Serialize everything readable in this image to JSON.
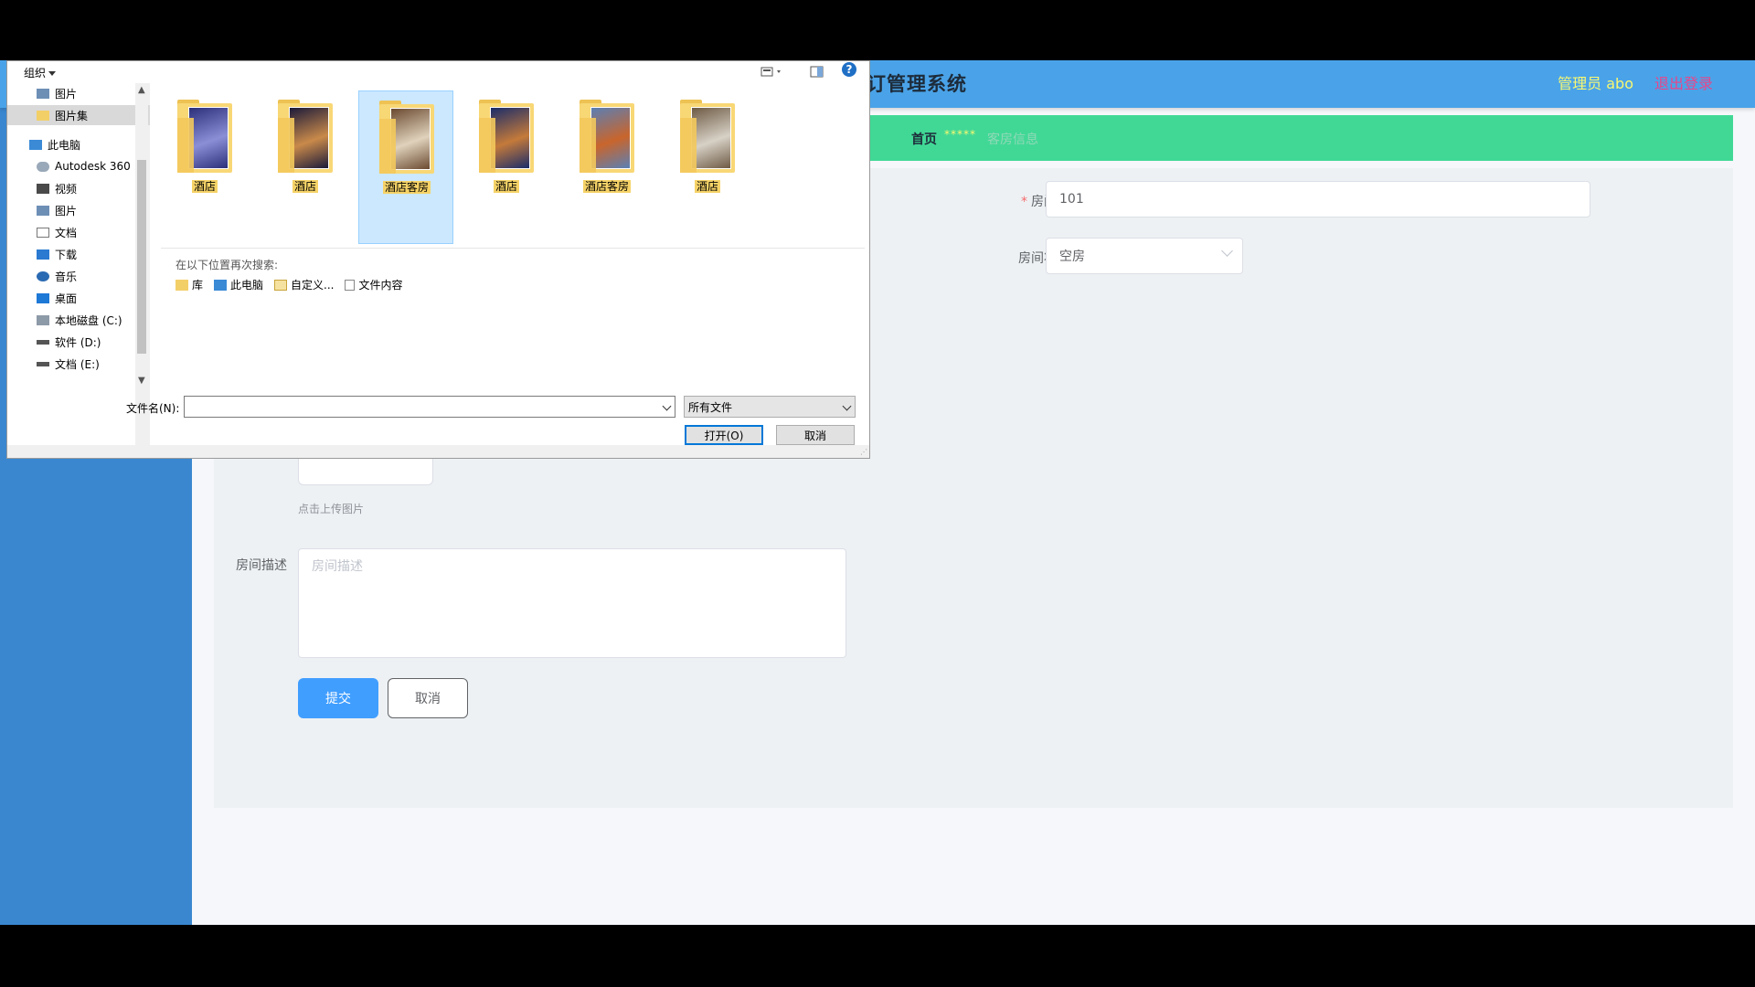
{
  "app": {
    "title": "酒店管理系统",
    "title_visible": "订管理系统",
    "admin": "管理员 abo",
    "logout": "退出登录"
  },
  "breadcrumb": {
    "home": "首页",
    "stars": "*****",
    "current": "客房信息"
  },
  "form": {
    "room_no_label": "房间号",
    "room_no_value": "101",
    "room_status_label": "房间状态",
    "room_status_value": "空房",
    "upload_hint": "点击上传图片",
    "description_label": "房间描述",
    "description_placeholder": "房间描述",
    "submit": "提交",
    "cancel": "取消"
  },
  "dialog": {
    "organize": "组织",
    "help": "?",
    "nav": [
      {
        "label": "图片",
        "icon": "pictures-icon",
        "pinned": true
      },
      {
        "label": "图片集",
        "icon": "folder-icon",
        "pinned": true,
        "selected": true
      },
      {
        "label": "此电脑",
        "icon": "computer-icon"
      },
      {
        "label": "Autodesk 360",
        "icon": "cloud-icon"
      },
      {
        "label": "视频",
        "icon": "video-icon"
      },
      {
        "label": "图片",
        "icon": "pictures-icon"
      },
      {
        "label": "文档",
        "icon": "documents-icon"
      },
      {
        "label": "下载",
        "icon": "download-icon"
      },
      {
        "label": "音乐",
        "icon": "music-icon"
      },
      {
        "label": "桌面",
        "icon": "desktop-icon"
      },
      {
        "label": "本地磁盘 (C:)",
        "icon": "drive-c-icon"
      },
      {
        "label": "软件 (D:)",
        "icon": "drive-icon"
      },
      {
        "label": "文档 (E:)",
        "icon": "drive-icon"
      }
    ],
    "files": [
      {
        "label": "酒店",
        "colors": [
          "#2c2f7a",
          "#8a8fd6"
        ]
      },
      {
        "label": "酒店",
        "colors": [
          "#1b1a3a",
          "#c98a4a"
        ]
      },
      {
        "label": "酒店客房",
        "colors": [
          "#6b4a30",
          "#e0d2bc"
        ],
        "selected": true
      },
      {
        "label": "酒店",
        "colors": [
          "#1a2c6a",
          "#c47a3a"
        ]
      },
      {
        "label": "酒店客房",
        "colors": [
          "#5a7fb5",
          "#c9652c"
        ]
      },
      {
        "label": "酒店",
        "colors": [
          "#6e5a44",
          "#d7d1c6"
        ]
      }
    ],
    "search_again": "在以下位置再次搜索:",
    "search_locations": [
      "库",
      "此电脑",
      "自定义...",
      "文件内容"
    ],
    "filename_label": "文件名(N):",
    "filename_value": "",
    "filetype_value": "所有文件",
    "open_button": "打开(O)",
    "cancel_button": "取消"
  }
}
